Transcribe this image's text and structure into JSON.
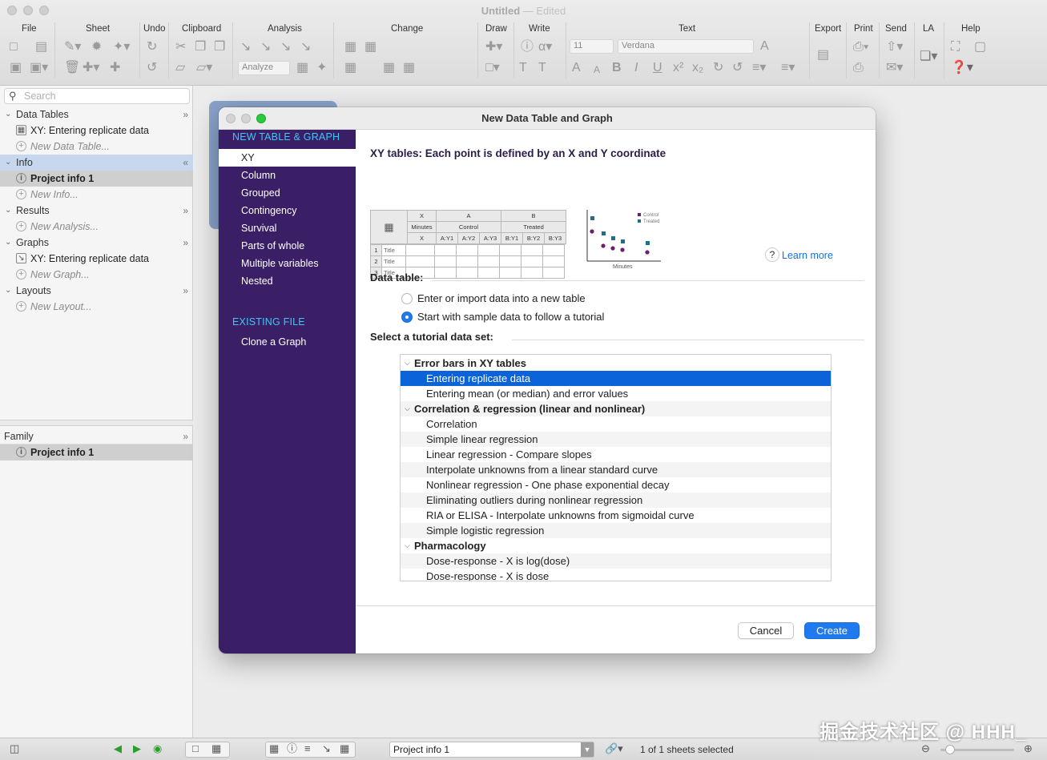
{
  "window": {
    "title": "Untitled",
    "status": "— Edited"
  },
  "toolbar": {
    "groups": [
      "File",
      "Sheet",
      "Undo",
      "Clipboard",
      "Analysis",
      "Change",
      "Draw",
      "Write",
      "Text",
      "Export",
      "Print",
      "Send",
      "LA",
      "Help"
    ],
    "analyze_label": "Analyze",
    "font_size": "11",
    "font_name": "Verdana"
  },
  "sidebar": {
    "search_placeholder": "Search",
    "sections": {
      "data_tables": {
        "label": "Data Tables",
        "item": "XY: Entering replicate data",
        "new": "New Data Table..."
      },
      "info": {
        "label": "Info",
        "item": "Project info 1",
        "new": "New Info..."
      },
      "results": {
        "label": "Results",
        "new": "New Analysis..."
      },
      "graphs": {
        "label": "Graphs",
        "item": "XY: Entering replicate data",
        "new": "New Graph..."
      },
      "layouts": {
        "label": "Layouts",
        "new": "New Layout..."
      }
    },
    "family": {
      "label": "Family",
      "item": "Project info 1"
    }
  },
  "dialog": {
    "title": "New Data Table and Graph",
    "new_header": "NEW TABLE & GRAPH",
    "types": [
      "XY",
      "Column",
      "Grouped",
      "Contingency",
      "Survival",
      "Parts of whole",
      "Multiple variables",
      "Nested"
    ],
    "selected_type": "XY",
    "existing_header": "EXISTING FILE",
    "existing_items": [
      "Clone a Graph"
    ],
    "heading": "XY tables: Each point is defined by an X and Y coordinate",
    "learn_more": "Learn more",
    "preview_table": {
      "col_groups": [
        "X",
        "A",
        "B"
      ],
      "group_titles": [
        "Minutes",
        "Control",
        "Treated"
      ],
      "sub_cols": [
        "X",
        "A:Y1",
        "A:Y2",
        "A:Y3",
        "B:Y1",
        "B:Y2",
        "B:Y3"
      ],
      "rows": [
        {
          "n": "1",
          "t": "Title"
        },
        {
          "n": "2",
          "t": "Title"
        },
        {
          "n": "3",
          "t": "Title"
        }
      ]
    },
    "preview_graph": {
      "legend": [
        "Control",
        "Treated"
      ],
      "xlabel": "Minutes",
      "legend_colors": [
        "#6b1f6b",
        "#1d6f8a"
      ]
    },
    "data_table_label": "Data table:",
    "radio_options": [
      "Enter or import data into a new table",
      "Start with sample data to follow a tutorial"
    ],
    "radio_selected": 1,
    "tutorial_label": "Select a tutorial data set:",
    "tutorial_rows": [
      {
        "kind": "group",
        "text": "Error bars in XY tables"
      },
      {
        "kind": "child",
        "text": "Entering replicate data",
        "selected": true
      },
      {
        "kind": "child",
        "text": "Entering mean (or median) and error values"
      },
      {
        "kind": "group",
        "text": "Correlation & regression (linear and nonlinear)"
      },
      {
        "kind": "child",
        "text": "Correlation"
      },
      {
        "kind": "child",
        "text": "Simple linear regression"
      },
      {
        "kind": "child",
        "text": "Linear regression - Compare slopes"
      },
      {
        "kind": "child",
        "text": "Interpolate unknowns from a linear standard curve"
      },
      {
        "kind": "child",
        "text": "Nonlinear regression - One phase exponential decay"
      },
      {
        "kind": "child",
        "text": "Eliminating outliers during nonlinear regression"
      },
      {
        "kind": "child",
        "text": "RIA or ELISA - Interpolate unknowns from sigmoidal curve"
      },
      {
        "kind": "child",
        "text": "Simple logistic regression"
      },
      {
        "kind": "group",
        "text": "Pharmacology"
      },
      {
        "kind": "child",
        "text": "Dose-response - X is log(dose)"
      },
      {
        "kind": "child",
        "text": "Dose-response - X is dose"
      }
    ],
    "cancel_label": "Cancel",
    "create_label": "Create"
  },
  "statusbar": {
    "sheet_name": "Project info 1",
    "sheets_count": "1 of 1 sheets selected"
  },
  "watermark": "掘金技术社区 @ HHH_"
}
